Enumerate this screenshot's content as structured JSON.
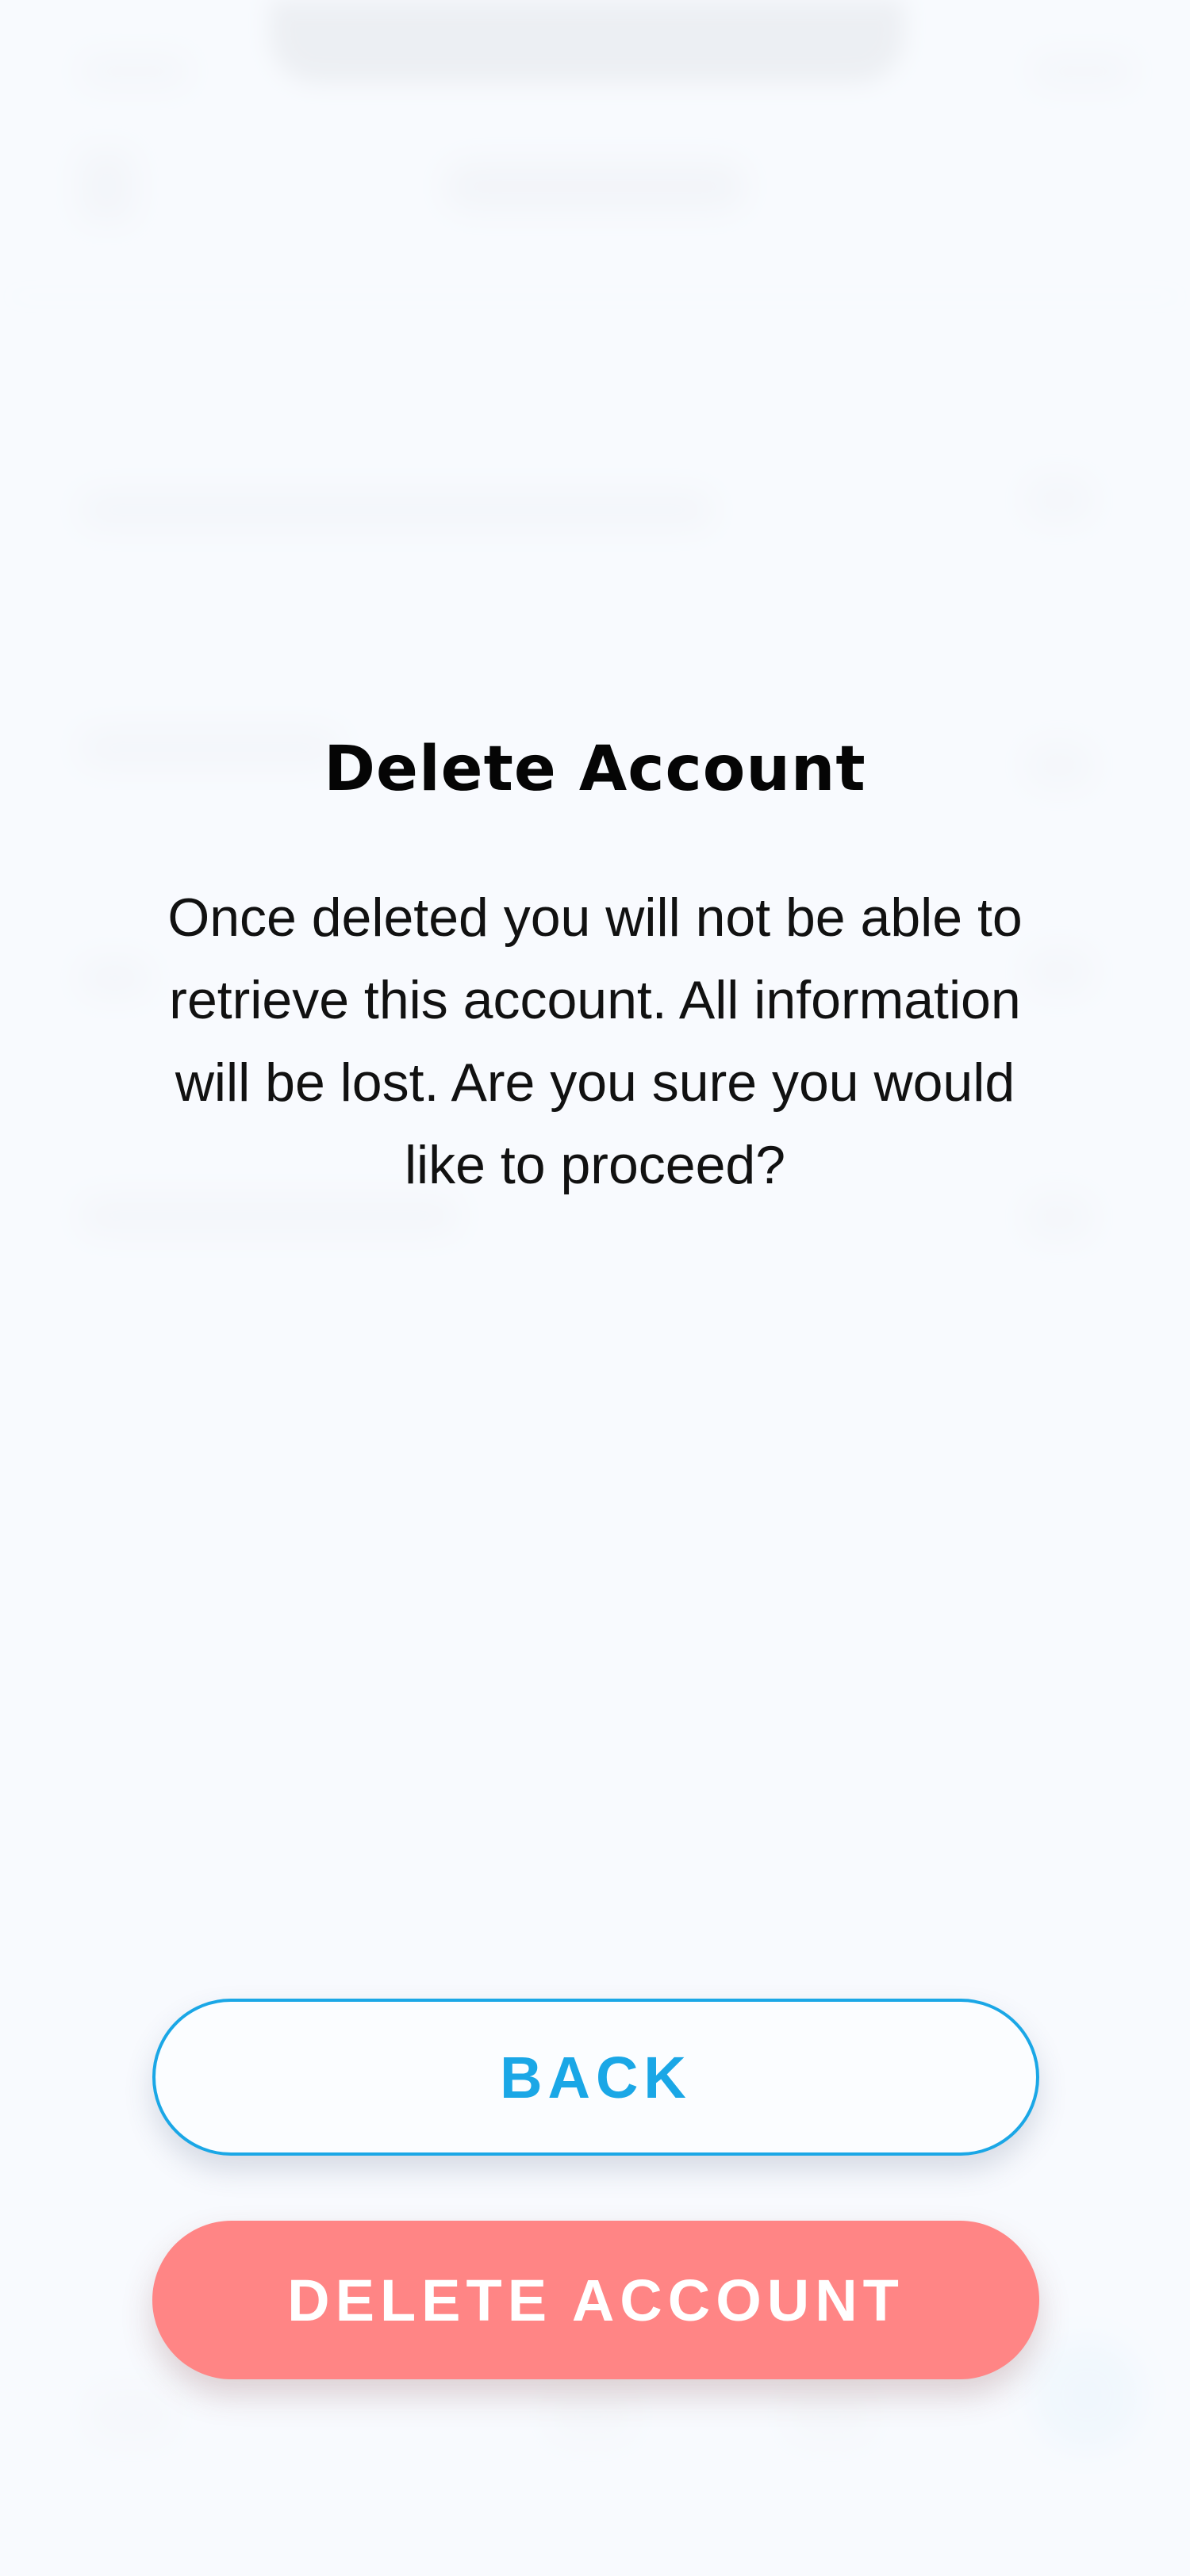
{
  "dialog": {
    "title": "Delete Account",
    "message": "Once deleted you will not be able to retrieve this account. All information will be lost. Are you sure you would like to proceed?"
  },
  "buttons": {
    "back_label": "BACK",
    "delete_label": "DELETE ACCOUNT"
  },
  "colors": {
    "accent": "#1aa7e6",
    "danger": "#ff8585",
    "background": "#f7f9fd",
    "title_text": "#050505"
  }
}
